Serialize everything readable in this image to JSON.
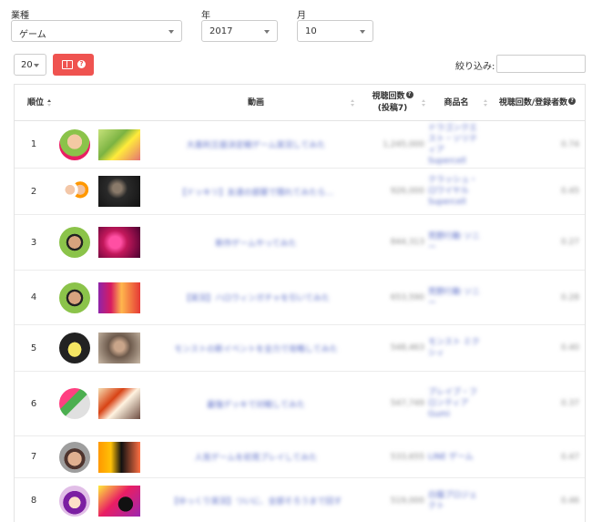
{
  "filters": {
    "industry": {
      "label": "業種",
      "value": "ゲーム"
    },
    "year": {
      "label": "年",
      "value": "2017"
    },
    "month": {
      "label": "月",
      "value": "10"
    }
  },
  "toolbar": {
    "page_size": "20",
    "column_button_icon": "columns-icon",
    "help_icon": "question-icon",
    "filter_label": "絞り込み:",
    "filter_value": ""
  },
  "table": {
    "headers": {
      "rank": "順位",
      "video": "動画",
      "views": "視聴回数",
      "views_sub": "(投稿7)",
      "product": "商品名",
      "ratio": "視聴回数/登録者数"
    },
    "rows": [
      {
        "rank": "1",
        "title": "大喜利王座決定戦ゲーム実況してみた",
        "views": "1,245,000",
        "product": "ドラゴンクエスト・ソリティア Supercell",
        "ratio": "0.74"
      },
      {
        "rank": "2",
        "title": "【ドッキリ】友達の部屋で隠れてみたら…",
        "views": "926,000",
        "product": "クラッシュ・ロワイヤル Supercell",
        "ratio": "0.45"
      },
      {
        "rank": "3",
        "title": "新作ゲームやってみた",
        "views": "844,313",
        "product": "荒野行動 ソニー",
        "ratio": "0.27"
      },
      {
        "rank": "4",
        "title": "【実況】ハロウィンガチャを引いてみた",
        "views": "653,590",
        "product": "荒野行動 ソニー",
        "ratio": "0.28"
      },
      {
        "rank": "5",
        "title": "モンストの新イベントを全力で攻略してみた",
        "views": "548,463",
        "product": "モンスト ミクシィ",
        "ratio": "0.40"
      },
      {
        "rank": "6",
        "title": "最強デッキで対戦してみた",
        "views": "547,749",
        "product": "ブレイブ・フロンティア Gumi",
        "ratio": "0.37"
      },
      {
        "rank": "7",
        "title": "人気ゲームを初見プレイしてみた",
        "views": "533,655",
        "product": "LINE ゲーム",
        "ratio": "0.47"
      },
      {
        "rank": "8",
        "title": "【ゆっくり実況】ついに、全部そろうまで回す",
        "views": "519,000",
        "product": "白猫プロジェクト",
        "ratio": "0.46"
      }
    ]
  },
  "colors": {
    "accent": "#ef5350",
    "link": "#5b6dc7",
    "border": "#e3e3e3"
  }
}
